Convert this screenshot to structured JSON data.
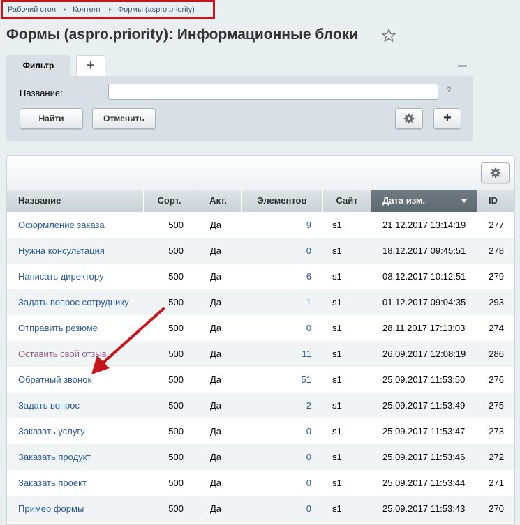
{
  "breadcrumb": {
    "items": [
      "Рабочий стол",
      "Контент",
      "Формы (aspro.priority)"
    ]
  },
  "page": {
    "title": "Формы (aspro.priority): Информационные блоки"
  },
  "filter": {
    "tab_label": "Фильтр",
    "add_tab_label": "+",
    "name_label": "Название:",
    "name_value": "",
    "help": "?",
    "find_label": "Найти",
    "cancel_label": "Отменить",
    "plus_label": "+"
  },
  "table": {
    "columns": [
      "Название",
      "Сорт.",
      "Акт.",
      "Элементов",
      "Сайт",
      "Дата изм.",
      "ID"
    ],
    "sorted_column": "Дата изм.",
    "rows": [
      {
        "name": "Оформление заказа",
        "sort": "500",
        "active": "Да",
        "elements": "9",
        "site": "s1",
        "date": "21.12.2017 13:14:19",
        "id": "277"
      },
      {
        "name": "Нужна консультация",
        "sort": "500",
        "active": "Да",
        "elements": "0",
        "site": "s1",
        "date": "18.12.2017 09:45:51",
        "id": "278"
      },
      {
        "name": "Написать директору",
        "sort": "500",
        "active": "Да",
        "elements": "6",
        "site": "s1",
        "date": "08.12.2017 10:12:51",
        "id": "279"
      },
      {
        "name": "Задать вопрос сотруднику",
        "sort": "500",
        "active": "Да",
        "elements": "1",
        "site": "s1",
        "date": "01.12.2017 09:04:35",
        "id": "293"
      },
      {
        "name": "Отправить резюме",
        "sort": "500",
        "active": "Да",
        "elements": "0",
        "site": "s1",
        "date": "28.11.2017 17:13:03",
        "id": "274"
      },
      {
        "name": "Оставить свой отзыв",
        "sort": "500",
        "active": "Да",
        "elements": "11",
        "site": "s1",
        "date": "26.09.2017 12:08:19",
        "id": "286"
      },
      {
        "name": "Обратный звонок",
        "sort": "500",
        "active": "Да",
        "elements": "51",
        "site": "s1",
        "date": "25.09.2017 11:53:50",
        "id": "276"
      },
      {
        "name": "Задать вопрос",
        "sort": "500",
        "active": "Да",
        "elements": "2",
        "site": "s1",
        "date": "25.09.2017 11:53:49",
        "id": "275"
      },
      {
        "name": "Заказать услугу",
        "sort": "500",
        "active": "Да",
        "elements": "0",
        "site": "s1",
        "date": "25.09.2017 11:53:47",
        "id": "273"
      },
      {
        "name": "Заказать продукт",
        "sort": "500",
        "active": "Да",
        "elements": "0",
        "site": "s1",
        "date": "25.09.2017 11:53:46",
        "id": "272"
      },
      {
        "name": "Заказать проект",
        "sort": "500",
        "active": "Да",
        "elements": "0",
        "site": "s1",
        "date": "25.09.2017 11:53:44",
        "id": "271"
      },
      {
        "name": "Пример формы",
        "sort": "500",
        "active": "Да",
        "elements": "0",
        "site": "s1",
        "date": "25.09.2017 11:53:43",
        "id": "270"
      }
    ]
  },
  "colors": {
    "link": "#2a5b98",
    "visited_link": "#8e5a8b",
    "highlight_border": "#c4161c",
    "arrow": "#c4161c"
  },
  "icons": [
    "star-icon",
    "gear-icon",
    "plus-icon",
    "minus-icon",
    "help-icon",
    "sort-down-icon",
    "breadcrumb-arrow-icon"
  ]
}
